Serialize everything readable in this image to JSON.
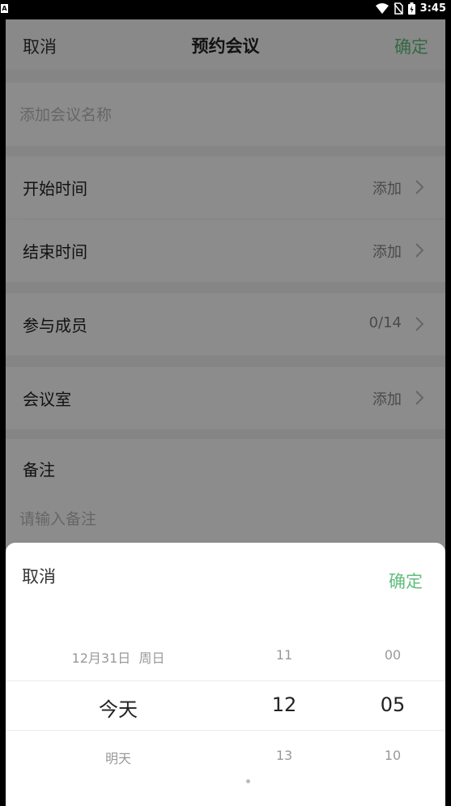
{
  "status_bar": {
    "time": "3:45",
    "left_icon": "A"
  },
  "header": {
    "cancel": "取消",
    "title": "预约会议",
    "confirm": "确定"
  },
  "meeting_name": {
    "placeholder": "添加会议名称"
  },
  "rows": {
    "start_time": {
      "label": "开始时间",
      "value": "添加"
    },
    "end_time": {
      "label": "结束时间",
      "value": "添加"
    },
    "members": {
      "label": "参与成员",
      "value": "0/14"
    },
    "room": {
      "label": "会议室",
      "value": "添加"
    }
  },
  "notes": {
    "label": "备注",
    "placeholder": "请输入备注"
  },
  "picker": {
    "cancel": "取消",
    "confirm": "确定",
    "date": {
      "prev": "12月31日  周日",
      "current": "今天",
      "next": "明天"
    },
    "hour": {
      "prev": "11",
      "current": "12",
      "next": "13"
    },
    "minute": {
      "prev": "00",
      "current": "05",
      "next": "10"
    }
  },
  "colors": {
    "accent": "#5fbf7c",
    "overlay": "rgba(0,0,0,0.45)"
  }
}
